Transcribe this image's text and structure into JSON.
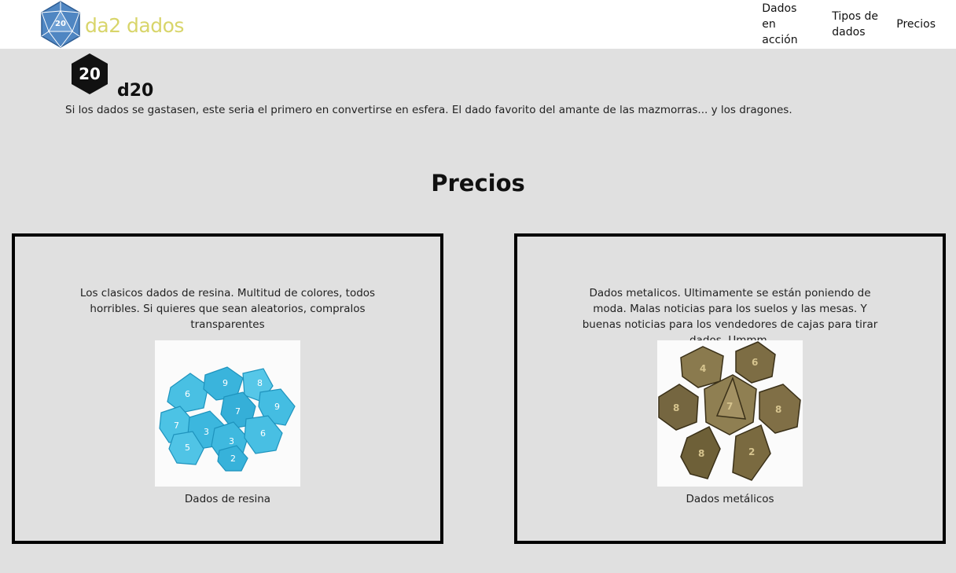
{
  "header": {
    "brand": "da2 dados",
    "logo_icon": "d20-logo-icon",
    "logo_number": "20",
    "brand_color": "#d8d56a",
    "nav": [
      {
        "label": "Dados en acción"
      },
      {
        "label": "Tipos de dados"
      },
      {
        "label": "Precios"
      }
    ]
  },
  "d20": {
    "icon_number": "20",
    "title": "d20",
    "description": "Si los dados se gastasen, este seria el primero en convertirse en esfera. El dado favorito del amante de las mazmorras... y los dragones."
  },
  "prices": {
    "title": "Precios",
    "cards": [
      {
        "text": "Los clasicos dados de resina. Multitud de colores, todos horribles. Si quieres que sean aleatorios, compralos transparentes",
        "image": "blue-resin-dice-photo",
        "caption": "Dados de resina"
      },
      {
        "text": "Dados metalicos. Ultimamente se están poniendo de moda. Malas noticias para los suelos y las mesas. Y buenas noticias para los vendedores de cajas para tirar dados. Ummm.",
        "image": "metal-dice-photo",
        "caption": "Dados metálicos"
      }
    ]
  },
  "colors": {
    "background": "#e0e0e0",
    "header_bg": "#ffffff",
    "card_border": "#000000",
    "resin_dice": "#3ab4dc",
    "metal_dice": "#6b5b36"
  }
}
